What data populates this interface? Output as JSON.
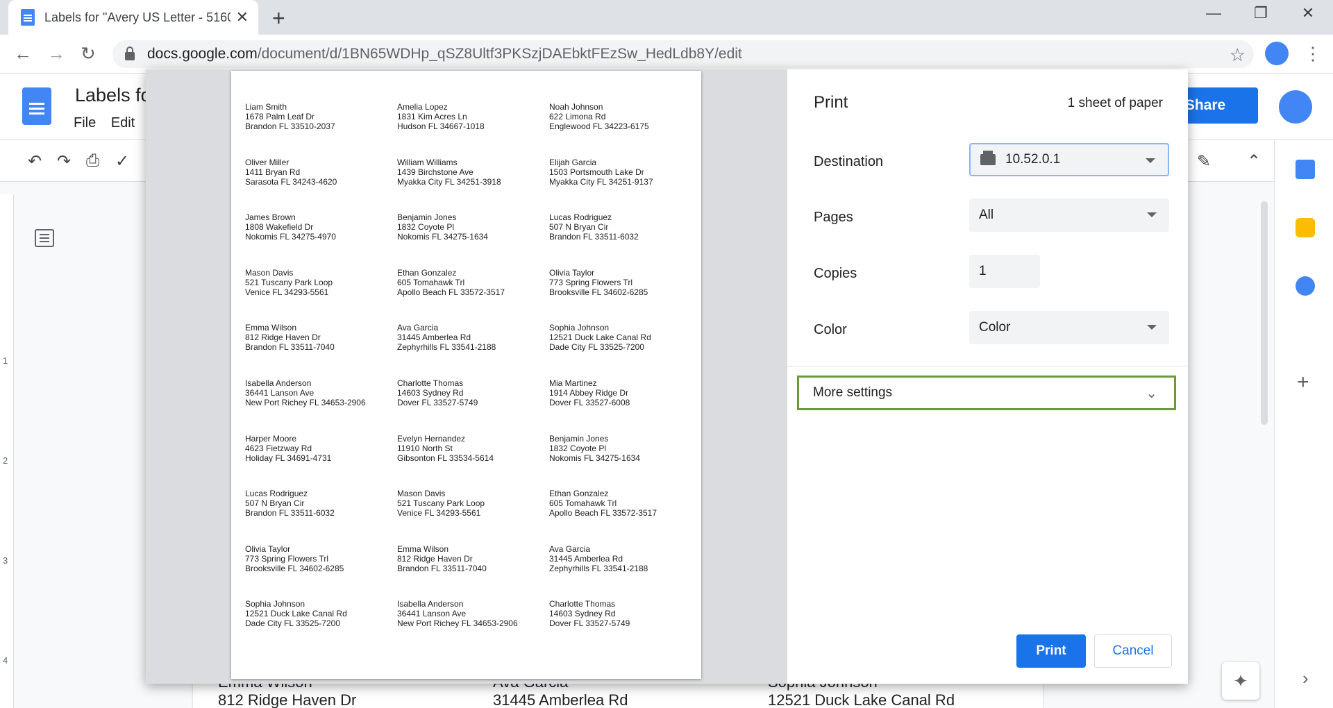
{
  "browser": {
    "tab_title": "Labels for \"Avery US Letter - 5160",
    "url_main": "docs.google.com",
    "url_path": "/document/d/1BN65WDHp_qSZ8Ultf3PKSzjDAEbktFEzSw_HedLdb8Y/edit",
    "new_tab_glyph": "+",
    "close_glyph": "✕",
    "back_glyph": "←",
    "forward_glyph": "→",
    "reload_glyph": "↻",
    "star_glyph": "☆",
    "kebab_glyph": "⋮",
    "minimize_glyph": "—",
    "restore_glyph": "❐"
  },
  "docs": {
    "title": "Labels fo",
    "menu": [
      "File",
      "Edit"
    ],
    "share_label": "Share",
    "ruler_numbers": [
      "1",
      "2",
      "3",
      "4"
    ],
    "background_labels": [
      {
        "line1": "Emma Wilson",
        "line2": "812 Ridge Haven Dr"
      },
      {
        "line1": "Ava Garcia",
        "line2": "31445 Amberlea Rd"
      },
      {
        "line1": "Sophia Johnson",
        "line2": "12521 Duck Lake Canal Rd"
      }
    ]
  },
  "print_dialog": {
    "title": "Print",
    "sheet_count": "1 sheet of paper",
    "destination_label": "Destination",
    "destination_value": "10.52.0.1",
    "pages_label": "Pages",
    "pages_value": "All",
    "copies_label": "Copies",
    "copies_value": "1",
    "color_label": "Color",
    "color_value": "Color",
    "more_settings_label": "More settings",
    "print_button": "Print",
    "cancel_button": "Cancel"
  },
  "labels": [
    [
      "Liam Smith",
      "1678 Palm Leaf Dr",
      "Brandon FL 33510-2037"
    ],
    [
      "Amelia Lopez",
      "1831 Kim Acres Ln",
      "Hudson FL 34667-1018"
    ],
    [
      "Noah Johnson",
      "622 Limona Rd",
      "Englewood FL 34223-6175"
    ],
    [
      "Oliver Miller",
      "1411 Bryan Rd",
      "Sarasota FL 34243-4620"
    ],
    [
      "William Williams",
      "1439 Birchstone Ave",
      "Myakka City FL 34251-3918"
    ],
    [
      "Elijah Garcia",
      "1503 Portsmouth Lake Dr",
      "Myakka City FL 34251-9137"
    ],
    [
      "James Brown",
      "1808 Wakefield Dr",
      "Nokomis FL 34275-4970"
    ],
    [
      "Benjamin Jones",
      "1832 Coyote Pl",
      "Nokomis FL 34275-1634"
    ],
    [
      "Lucas Rodriguez",
      "507 N Bryan Cir",
      "Brandon FL 33511-6032"
    ],
    [
      "Mason Davis",
      "521 Tuscany Park Loop",
      "Venice FL 34293-5561"
    ],
    [
      "Ethan Gonzalez",
      "605 Tomahawk Trl",
      "Apollo Beach FL 33572-3517"
    ],
    [
      "Olivia Taylor",
      "773 Spring Flowers Trl",
      "Brooksville FL 34602-6285"
    ],
    [
      "Emma Wilson",
      "812 Ridge Haven Dr",
      "Brandon FL 33511-7040"
    ],
    [
      "Ava Garcia",
      "31445 Amberlea Rd",
      "Zephyrhills FL 33541-2188"
    ],
    [
      "Sophia Johnson",
      "12521 Duck Lake Canal Rd",
      "Dade City FL 33525-7200"
    ],
    [
      "Isabella Anderson",
      "36441 Lanson Ave",
      "New Port Richey FL 34653-2906"
    ],
    [
      "Charlotte Thomas",
      "14603 Sydney Rd",
      "Dover FL 33527-5749"
    ],
    [
      "Mia Martinez",
      "1914 Abbey Ridge Dr",
      "Dover FL 33527-6008"
    ],
    [
      "Harper Moore",
      "4623 Fietzway Rd",
      "Holiday FL 34691-4731"
    ],
    [
      "Evelyn Hernandez",
      "11910 North St",
      "Gibsonton FL 33534-5614"
    ],
    [
      "Benjamin Jones",
      "1832 Coyote Pl",
      "Nokomis FL 34275-1634"
    ],
    [
      "Lucas Rodriguez",
      "507 N Bryan Cir",
      "Brandon FL 33511-6032"
    ],
    [
      "Mason Davis",
      "521 Tuscany Park Loop",
      "Venice FL 34293-5561"
    ],
    [
      "Ethan Gonzalez",
      "605 Tomahawk Trl",
      "Apollo Beach FL 33572-3517"
    ],
    [
      "Olivia Taylor",
      "773 Spring Flowers Trl",
      "Brooksville FL 34602-6285"
    ],
    [
      "Emma Wilson",
      "812 Ridge Haven Dr",
      "Brandon FL 33511-7040"
    ],
    [
      "Ava Garcia",
      "31445 Amberlea Rd",
      "Zephyrhills FL 33541-2188"
    ],
    [
      "Sophia Johnson",
      "12521 Duck Lake Canal Rd",
      "Dade City FL 33525-7200"
    ],
    [
      "Isabella Anderson",
      "36441 Lanson Ave",
      "New Port Richey FL 34653-2906"
    ],
    [
      "Charlotte Thomas",
      "14603 Sydney Rd",
      "Dover FL 33527-5749"
    ]
  ],
  "colors": {
    "accent": "#1a73e8",
    "highlight_border": "#6a9a3a"
  }
}
